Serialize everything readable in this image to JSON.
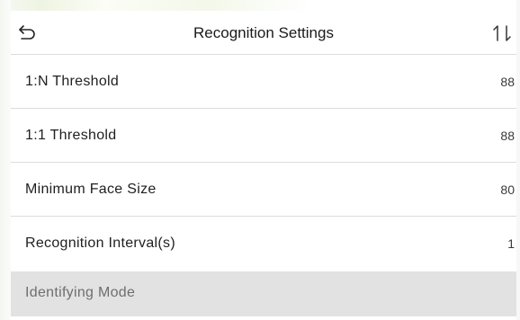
{
  "header": {
    "title": "Recognition Settings",
    "back_icon": "back-arrow-icon",
    "sort_icon": "sort-icon"
  },
  "settings": [
    {
      "label": "1:N Threshold",
      "value": "88"
    },
    {
      "label": "1:1 Threshold",
      "value": "88"
    },
    {
      "label": "Minimum Face Size",
      "value": "80"
    },
    {
      "label": "Recognition Interval(s)",
      "value": "1"
    }
  ],
  "section": {
    "label": "Identifying Mode"
  },
  "colors": {
    "section_bg": "#e2e2e2",
    "divider": "#dcdcdc",
    "text": "#1f1f1f"
  }
}
